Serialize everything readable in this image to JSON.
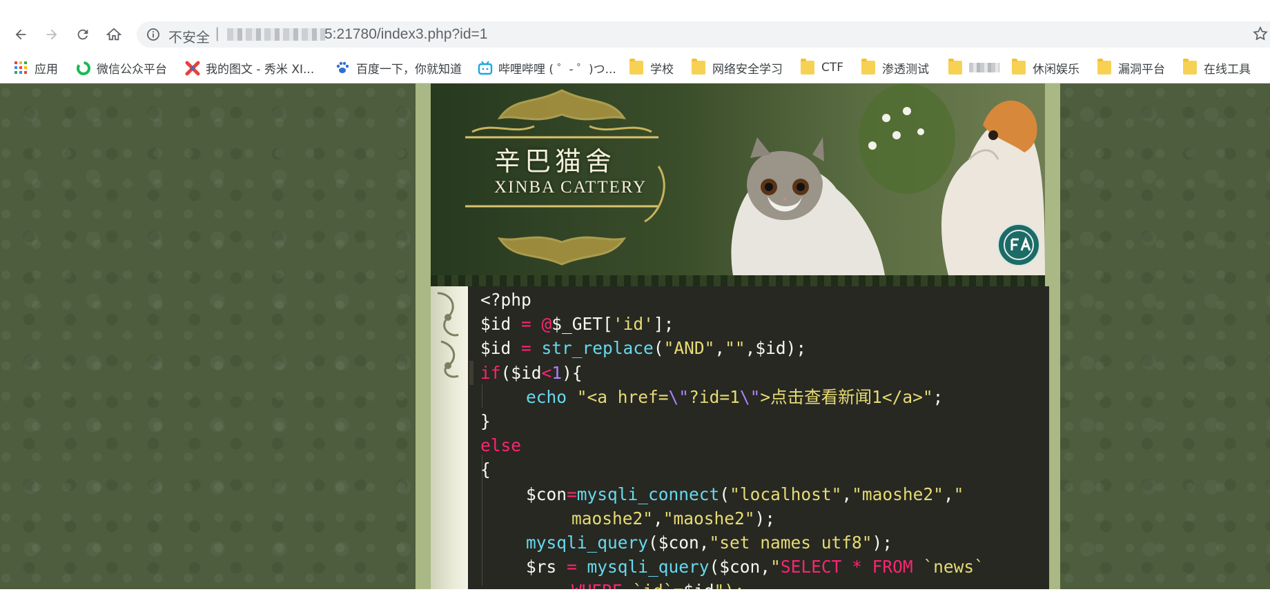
{
  "browser": {
    "insecure_label": "不安全",
    "separator": "|",
    "url_visible": "5:21780/index3.php?id=1"
  },
  "bookmarks": [
    {
      "label": "应用",
      "icon": "apps-grid-icon"
    },
    {
      "label": "微信公众平台",
      "icon": "wechat-mp-icon"
    },
    {
      "label": "我的图文 - 秀米 XI...",
      "icon": "xiumi-icon"
    },
    {
      "label": "百度一下，你就知道",
      "icon": "baidu-paw-icon"
    },
    {
      "label": "哔哩哔哩 ( ゜- ゜)つ...",
      "icon": "bilibili-tv-icon"
    },
    {
      "label": "学校",
      "icon": "folder-icon"
    },
    {
      "label": "网络安全学习",
      "icon": "folder-icon"
    },
    {
      "label": "CTF",
      "icon": "folder-icon"
    },
    {
      "label": "渗透测试",
      "icon": "folder-icon"
    },
    {
      "label": "",
      "icon": "folder-icon"
    },
    {
      "label": "休闲娱乐",
      "icon": "folder-icon"
    },
    {
      "label": "漏洞平台",
      "icon": "folder-icon"
    },
    {
      "label": "在线工具",
      "icon": "folder-icon"
    }
  ],
  "banner": {
    "title_cn": "辛巴猫舍",
    "title_en": "XINBA CATTERY"
  },
  "code": {
    "l1": "<?php",
    "l2a": "$id",
    "l2b": " = ",
    "l2c": "@",
    "l2d": "$_GET[",
    "l2e": "'id'",
    "l2f": "];",
    "l3a": "$id",
    "l3b": " = ",
    "l3c": "str_replace",
    "l3d": "(",
    "l3e": "\"AND\"",
    "l3f": ",",
    "l3g": "\"\"",
    "l3h": ",$id);",
    "l4a": "if",
    "l4b": "($id",
    "l4c": "<",
    "l4d": "1",
    "l4e": "){",
    "l5a": "echo",
    "l5b": " ",
    "l5c": "\"<a href=",
    "l5d": "\\\"",
    "l5e": "?id=1",
    "l5f": "\\\"",
    "l5g": ">点击查看新闻1</a>\"",
    "l5h": ";",
    "l6": "}",
    "l7": "else",
    "l8": "{",
    "l9a": "$con",
    "l9b": "=",
    "l9c": "mysqli_connect",
    "l9d": "(",
    "l9e": "\"localhost\"",
    "l9f": ",",
    "l9g": "\"maoshe2\"",
    "l9h": ",",
    "l9i": "\"",
    "l10a": "maoshe2\"",
    "l10b": ",",
    "l10c": "\"maoshe2\"",
    "l10d": ");",
    "l11a": "mysqli_query",
    "l11b": "($con,",
    "l11c": "\"set names utf8\"",
    "l11d": ");",
    "l12a": "$rs",
    "l12b": " = ",
    "l12c": "mysqli_query",
    "l12d": "($con,",
    "l12e": "\"",
    "l12f": "SELECT",
    "l12g": " ",
    "l12h": "*",
    "l12i": " ",
    "l12j": "FROM",
    "l12k": " `news`",
    "l13a": "WHERE",
    "l13b": " `id`=",
    "l13c": "$id",
    "l13d": "\");"
  },
  "colors": {
    "keyword_pink": "#f92672",
    "function_blue": "#66d9ef",
    "string_yellow": "#e6db74",
    "number_purple": "#ae81ff",
    "code_bg": "#272822"
  }
}
